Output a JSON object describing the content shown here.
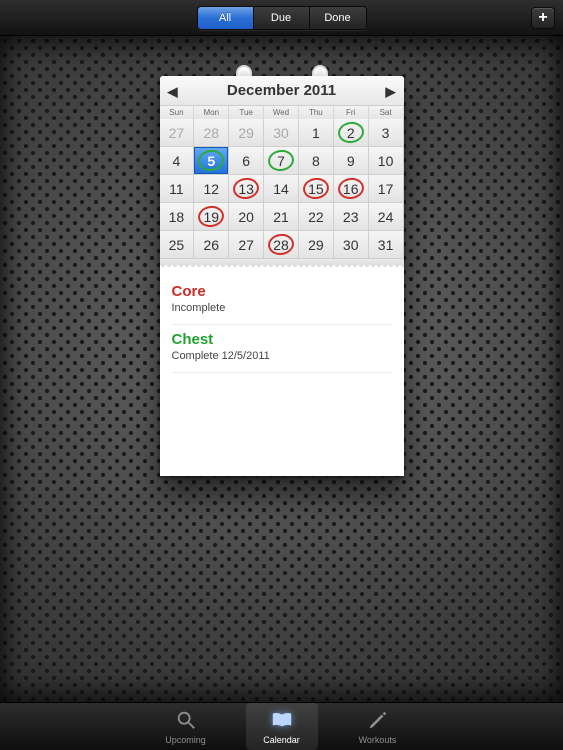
{
  "topbar": {
    "segments": [
      {
        "label": "All",
        "active": true
      },
      {
        "label": "Due",
        "active": false
      },
      {
        "label": "Done",
        "active": false
      }
    ],
    "add_label": "+"
  },
  "calendar": {
    "title": "December 2011",
    "weekdays": [
      "Sun",
      "Mon",
      "Tue",
      "Wed",
      "Thu",
      "Fri",
      "Sat"
    ],
    "rows": [
      [
        {
          "n": 27,
          "outside": true
        },
        {
          "n": 28,
          "outside": true
        },
        {
          "n": 29,
          "outside": true
        },
        {
          "n": 30,
          "outside": true
        },
        {
          "n": 1
        },
        {
          "n": 2,
          "mark": "green"
        },
        {
          "n": 3
        }
      ],
      [
        {
          "n": 4
        },
        {
          "n": 5,
          "today": true,
          "mark": "green"
        },
        {
          "n": 6
        },
        {
          "n": 7,
          "mark": "green"
        },
        {
          "n": 8
        },
        {
          "n": 9
        },
        {
          "n": 10
        }
      ],
      [
        {
          "n": 11
        },
        {
          "n": 12
        },
        {
          "n": 13,
          "mark": "red"
        },
        {
          "n": 14
        },
        {
          "n": 15,
          "mark": "red"
        },
        {
          "n": 16,
          "mark": "red"
        },
        {
          "n": 17
        }
      ],
      [
        {
          "n": 18
        },
        {
          "n": 19,
          "mark": "red"
        },
        {
          "n": 20
        },
        {
          "n": 21
        },
        {
          "n": 22
        },
        {
          "n": 23
        },
        {
          "n": 24
        }
      ],
      [
        {
          "n": 25
        },
        {
          "n": 26
        },
        {
          "n": 27
        },
        {
          "n": 28,
          "mark": "red"
        },
        {
          "n": 29
        },
        {
          "n": 30
        },
        {
          "n": 31
        }
      ]
    ]
  },
  "notes": [
    {
      "title": "Core",
      "subtitle": "Incomplete",
      "color": "red"
    },
    {
      "title": "Chest",
      "subtitle": "Complete 12/5/2011",
      "color": "green"
    }
  ],
  "tabs": [
    {
      "label": "Upcoming",
      "icon": "search",
      "active": false
    },
    {
      "label": "Calendar",
      "icon": "book",
      "active": true
    },
    {
      "label": "Workouts",
      "icon": "pencil",
      "active": false
    }
  ]
}
